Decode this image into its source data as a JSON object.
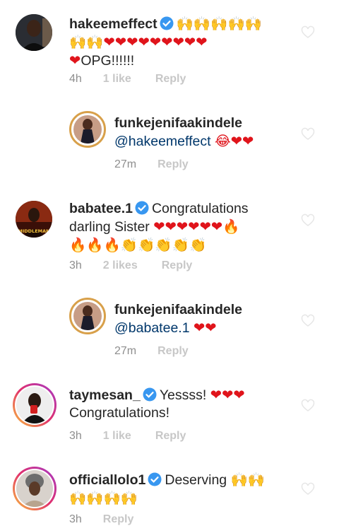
{
  "comments": [
    {
      "username": "hakeemeffect",
      "verified": true,
      "text_line1_emoji": "🙌🙌🙌🙌🙌",
      "text_line2_emoji": "🙌🙌❤❤❤❤❤❤❤❤❤",
      "text_line3_suffix": "OPG!!!!!!",
      "time": "4h",
      "likes": "1 like",
      "reply": "Reply"
    },
    {
      "username": "funkejenifaakindele",
      "mention": "@hakeemeffect",
      "emoji": "😂❤❤",
      "time": "27m",
      "reply": "Reply"
    },
    {
      "username": "babatee.1",
      "verified": true,
      "text_line1": "Congratulations",
      "text_line2": "darling Sister",
      "text_line2_emoji": "❤❤❤❤❤❤🔥",
      "text_line3_emoji": "🔥🔥🔥👏👏👏👏👏",
      "avatar_caption": "MIDDLEMAN",
      "time": "3h",
      "likes": "2 likes",
      "reply": "Reply"
    },
    {
      "username": "funkejenifaakindele",
      "mention": "@babatee.1",
      "emoji": "❤❤",
      "time": "27m",
      "reply": "Reply"
    },
    {
      "username": "taymesan_",
      "verified": true,
      "text_line1": "Yessss!",
      "text_line1_emoji": "❤❤❤",
      "text_line2": "Congratulations!",
      "time": "3h",
      "likes": "1 like",
      "reply": "Reply"
    },
    {
      "username": "officiallolo1",
      "verified": true,
      "text_line1": "Deserving",
      "text_line1_emoji": "🙌🙌",
      "text_line2_emoji": "🙌🙌🙌🙌",
      "time": "3h",
      "reply": "Reply"
    }
  ],
  "icons": {
    "verified": "verified-badge-icon",
    "like": "heart-outline-icon"
  },
  "colors": {
    "verified": "#3897f0",
    "mention": "#00376b",
    "meta": "#8e8e8e"
  }
}
